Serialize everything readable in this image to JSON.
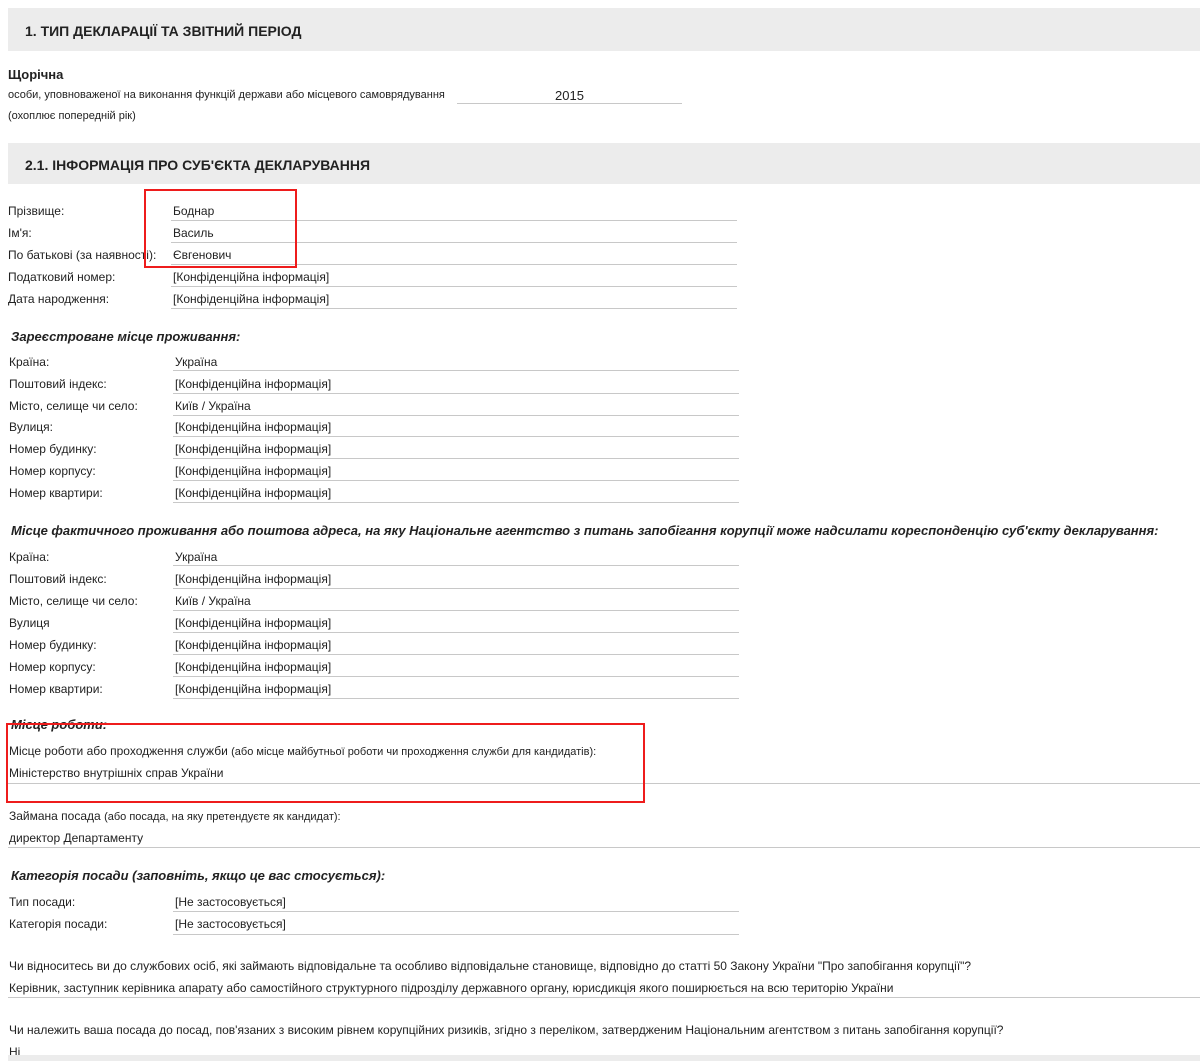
{
  "sec1": {
    "title": "1.   ТИП ДЕКЛАРАЦІЇ ТА ЗВІТНИЙ ПЕРІОД",
    "type": "Щорічна",
    "desc": "особи, уповноваженої на виконання функцій держави або місцевого самоврядування",
    "year": "2015",
    "note": "(охоплює попередній рік)"
  },
  "sec2": {
    "title": "2.1.   ІНФОРМАЦІЯ ПРО СУБ'ЄКТА ДЕКЛАРУВАННЯ",
    "personal": [
      {
        "label": "Прізвище:",
        "value": "Боднар"
      },
      {
        "label": "Ім'я:",
        "value": "Василь"
      },
      {
        "label": "По батькові (за наявності):",
        "value": "Євгенович"
      },
      {
        "label": "Податковий номер:",
        "value": "[Конфіденційна інформація]"
      },
      {
        "label": "Дата народження:",
        "value": "[Конфіденційна інформація]"
      }
    ],
    "registered": {
      "heading": "Зареєстроване місце проживання:",
      "rows": [
        {
          "label": "Країна:",
          "value": "Україна"
        },
        {
          "label": "Поштовий індекс:",
          "value": "[Конфіденційна інформація]"
        },
        {
          "label": "Місто, селище чи село:",
          "value": "Київ / Україна"
        },
        {
          "label": "Вулиця:",
          "value": "[Конфіденційна інформація]"
        },
        {
          "label": "Номер будинку:",
          "value": "[Конфіденційна інформація]"
        },
        {
          "label": "Номер корпусу:",
          "value": "[Конфіденційна інформація]"
        },
        {
          "label": "Номер квартири:",
          "value": "[Конфіденційна інформація]"
        }
      ]
    },
    "actual": {
      "heading": "Місце фактичного проживання або поштова адреса, на яку Національне агентство з питань запобігання корупції може надсилати кореспонденцію суб'єкту декларування:",
      "rows": [
        {
          "label": "Країна:",
          "value": "Україна"
        },
        {
          "label": "Поштовий індекс:",
          "value": "[Конфіденційна інформація]"
        },
        {
          "label": "Місто, селище чи село:",
          "value": "Київ / Україна"
        },
        {
          "label": "Вулиця",
          "value": "[Конфіденційна інформація]"
        },
        {
          "label": "Номер будинку:",
          "value": "[Конфіденційна інформація]"
        },
        {
          "label": "Номер корпусу:",
          "value": "[Конфіденційна інформація]"
        },
        {
          "label": "Номер квартири:",
          "value": "[Конфіденційна інформація]"
        }
      ]
    },
    "work": {
      "heading": "Місце роботи:",
      "place_label_main": "Місце роботи або проходження служби",
      "place_label_sub": "(або місце майбутньої роботи чи проходження служби для кандидатів):",
      "place_value": "Міністерство внутрішніх справ України",
      "position_label_main": "Займана посада",
      "position_label_sub": "(або посада, на яку претендуєте як кандидат):",
      "position_value": "директор Департаменту"
    },
    "category": {
      "heading": "Категорія посади (заповніть, якщо це вас стосується):",
      "rows": [
        {
          "label": "Тип посади:",
          "value": "[Не застосовується]"
        },
        {
          "label": "Категорія посади:",
          "value": "[Не застосовується]"
        }
      ]
    },
    "q1": "Чи відноситесь ви до службових осіб, які займають відповідальне та особливо відповідальне становище, відповідно до статті 50 Закону України \"Про запобігання корупції\"?",
    "a1": "Керівник, заступник керівника апарату або самостійного структурного підрозділу державного органу, юрисдикція якого поширюється на всю територію України",
    "q2": "Чи належить ваша посада до посад, пов'язаних з високим рівнем корупційних ризиків, згідно з переліком, затвердженим Національним агентством з питань запобігання корупції?",
    "a2": "Ні"
  },
  "colors": {
    "highlight": "#ee1c1c",
    "section_bg": "#ececec",
    "line": "#c8c8c8"
  }
}
